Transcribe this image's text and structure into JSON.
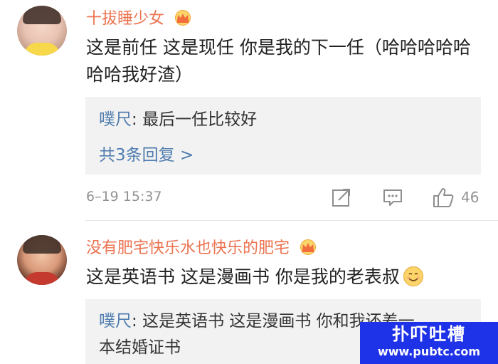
{
  "comments": [
    {
      "username": "十拔睡少女",
      "text": "这是前任 这是现任 你是我的下一任（哈哈哈哈哈哈哈我好渣）",
      "reply": {
        "name": "噗尺",
        "separator": ": ",
        "text": "最后一任比较好"
      },
      "more_replies": "共3条回复 >",
      "time": "6–19 15:37",
      "likes": "46"
    },
    {
      "username": "没有肥宅快乐水也快乐的肥宅",
      "text": "这是英语书 这是漫画书 你是我的老表叔",
      "reply": {
        "name": "噗尺",
        "separator": ": ",
        "text": "这是英语书 这是漫画书 你和我还差一",
        "text2": "本结婚证书"
      }
    }
  ],
  "watermark": {
    "title": "扑吓吐槽",
    "url": "www.pubtc.com"
  },
  "colors": {
    "username": "#eb7350",
    "link": "#507daf",
    "reply_bg": "#f2f2f2",
    "meta": "#939393",
    "watermark_bg": "#1e32e8"
  },
  "icons": [
    "crown-icon",
    "share-icon",
    "comment-icon",
    "like-icon",
    "smiley-icon"
  ]
}
